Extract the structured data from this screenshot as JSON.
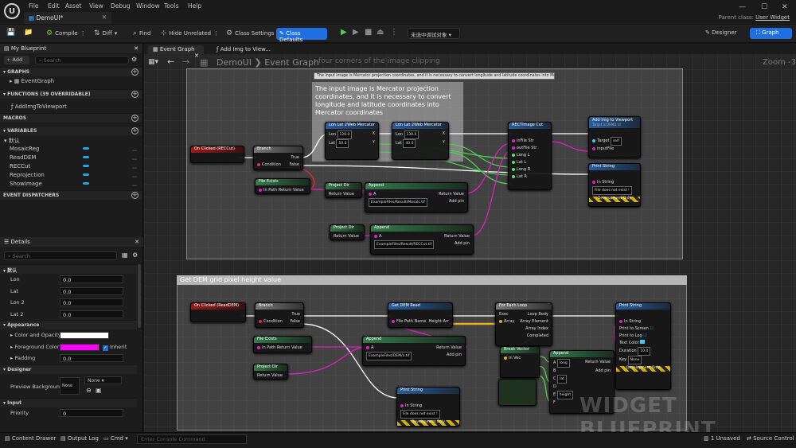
{
  "app": {
    "menu": [
      "File",
      "Edit",
      "Asset",
      "View",
      "Debug",
      "Window",
      "Tools",
      "Help"
    ],
    "doc_tab": "DemoUI*",
    "parent_class_label": "Parent class:",
    "parent_class_value": "User Widget"
  },
  "toolbar": {
    "compile": "Compile",
    "diff": "Diff",
    "find": "Find",
    "hide_unrelated": "Hide Unrelated",
    "class_settings": "Class Settings",
    "class_defaults": "Class Defaults",
    "debug_filter": "未选中调试对象",
    "designer": "Designer",
    "graph": "Graph"
  },
  "blueprint": {
    "tab": "My Blueprint",
    "add": "Add",
    "search_placeholder": "Search",
    "graphs_header": "GRAPHS",
    "graphs": [
      "EventGraph"
    ],
    "functions_header": "FUNCTIONS (39 OVERRIDABLE)",
    "functions": [
      "AddImgToViewport"
    ],
    "macros_header": "MACROS",
    "variables_header": "VARIABLES",
    "var_category": "默认",
    "variables": [
      "MosaicReg",
      "ReadDEM",
      "RECCut",
      "Reprojection",
      "ShowImage"
    ],
    "dispatchers_header": "EVENT DISPATCHERS"
  },
  "details": {
    "tab": "Details",
    "search_placeholder": "Search",
    "default_header": "默认",
    "fields": [
      {
        "label": "Lon",
        "value": "0.0"
      },
      {
        "label": "Lat",
        "value": "0.0"
      },
      {
        "label": "Lon 2",
        "value": "0.0"
      },
      {
        "label": "Lat 2",
        "value": "0.0"
      }
    ],
    "appearance_header": "Appearance",
    "color_label": "Color and Opacity",
    "fg_label": "Foreground Color",
    "inherit": "Inherit",
    "padding_label": "Padding",
    "padding_value": "0.0",
    "designer_header": "Designer",
    "preview_bg_label": "Preview Background",
    "preview_none": "None",
    "preview_select": "None",
    "input_header": "Input",
    "priority_label": "Priority",
    "priority_value": "0",
    "fg_color": "#ff00ff"
  },
  "graph": {
    "tabs": [
      "Event Graph",
      "Add Img to View..."
    ],
    "breadcrumb_root": "DemoUI",
    "breadcrumb_leaf": "Event Graph",
    "zoom": "Zoom -3",
    "comment1_overlay": "four corners of the image clipping",
    "comment1_note": "The input image is Mercator projection coordinates, and it is necessary to convert longitude and latitude coordinates into Mercator coordinates",
    "comment1_big": "The input image is Mercator projection coordinates, and it is necessary to convert longitude and latitude coordinates into Mercator coordinates",
    "comment2_title": "Get DEM grid pixel height value",
    "watermark": "WIDGET BLUEPRINT",
    "nodes": {
      "on_clicked_rec": "On Clicked (RECCut)",
      "branch": "Branch",
      "true": "True",
      "false": "False",
      "condition": "Condition",
      "file_exists": "File Exists",
      "in_path": "In Path",
      "return_value": "Return Value",
      "project_dir": "Project Dir",
      "append": "Append",
      "add_pin": "Add pin",
      "lonlat1": "Lon Lat 2Web Mercator",
      "lonlat2": "Lon Lat 2Web Mercator",
      "lon": "Lon",
      "lat": "Lat",
      "lon_val1": "120.0",
      "lat_val1": "50.0",
      "lon_val2": "130.0",
      "lat_val2": "40.0",
      "x": "X",
      "y": "Y",
      "rec_cut": "RECTImage Cut",
      "in_file": "inFile Str",
      "out_file": "outFile Str",
      "long_l": "Long L",
      "lat_l": "Lat L",
      "long_r": "Long R",
      "lat_r": "Lat R",
      "add_img": "Add Img to Viewport",
      "add_img_sub": "Target is DEMO UI",
      "target": "Target",
      "self": "self",
      "input_file": "inputFile",
      "print_string": "Print String",
      "in_string": "In String",
      "file_not_exist": "File does not exist !",
      "dev_only": "Development Only",
      "mosaic_path": "ExampleFiles/Result/Mosaic.tif",
      "reccut_path": "ExampleFiles/Result/RECCut.tif",
      "on_clicked_dem": "On Clicked (ReadDEM)",
      "get_dem": "Get DEM Read",
      "file_path": "File Path Name",
      "height_arr": "Height Arr",
      "for_each": "For Each Loop",
      "exec": "Exec",
      "loop_body": "Loop Body",
      "array": "Array",
      "array_element": "Array Element",
      "array_index": "Array Index",
      "completed": "Completed",
      "break_vector": "Break Vector",
      "in_vec": "In Vec",
      "dem_path": "ExampleFiles/DEM/a.tif",
      "a": "A",
      "b": "B",
      "c": "C",
      "d": "D",
      "e": "E",
      "f": "F",
      "long_txt": "long",
      "lat_txt": "lat",
      "height_txt": "height",
      "print_to_screen": "Print to Screen",
      "print_to_log": "Print to Log",
      "text_color": "Text Color",
      "duration": "Duration",
      "duration_val": "10.0",
      "key": "Key",
      "key_val": "None"
    }
  },
  "statusbar": {
    "content_drawer": "Content Drawer",
    "output_log": "Output Log",
    "cmd": "Cmd",
    "console_placeholder": "Enter Console Command",
    "unsaved": "1 Unsaved",
    "source_control": "Source Control"
  }
}
